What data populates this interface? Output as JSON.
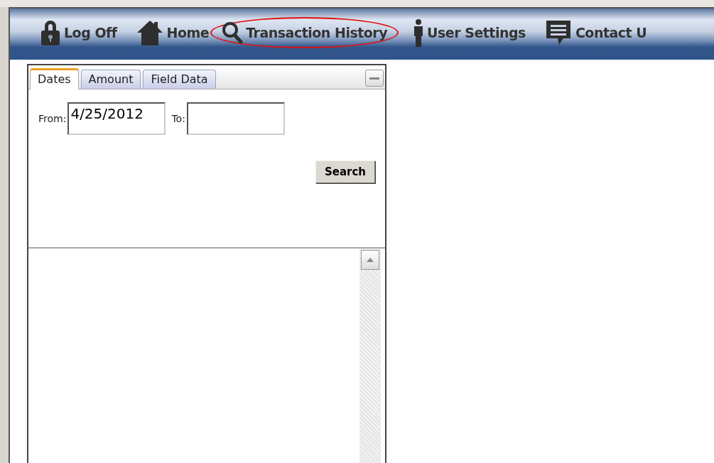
{
  "nav": [
    {
      "label": "Log Off",
      "kind": "lock",
      "circled": false
    },
    {
      "label": "Home",
      "kind": "home",
      "circled": false
    },
    {
      "label": "Transaction History",
      "kind": "search",
      "circled": true
    },
    {
      "label": "User Settings",
      "kind": "person",
      "circled": false
    },
    {
      "label": "Contact U",
      "kind": "chat",
      "circled": false
    }
  ],
  "tabs": [
    {
      "label": "Dates",
      "selected": true
    },
    {
      "label": "Amount",
      "selected": false
    },
    {
      "label": "Field Data",
      "selected": false
    }
  ],
  "fields": [
    {
      "label": "From:",
      "value": "4/25/2012"
    },
    {
      "label": "To:"
    }
  ],
  "search_button": "Search"
}
